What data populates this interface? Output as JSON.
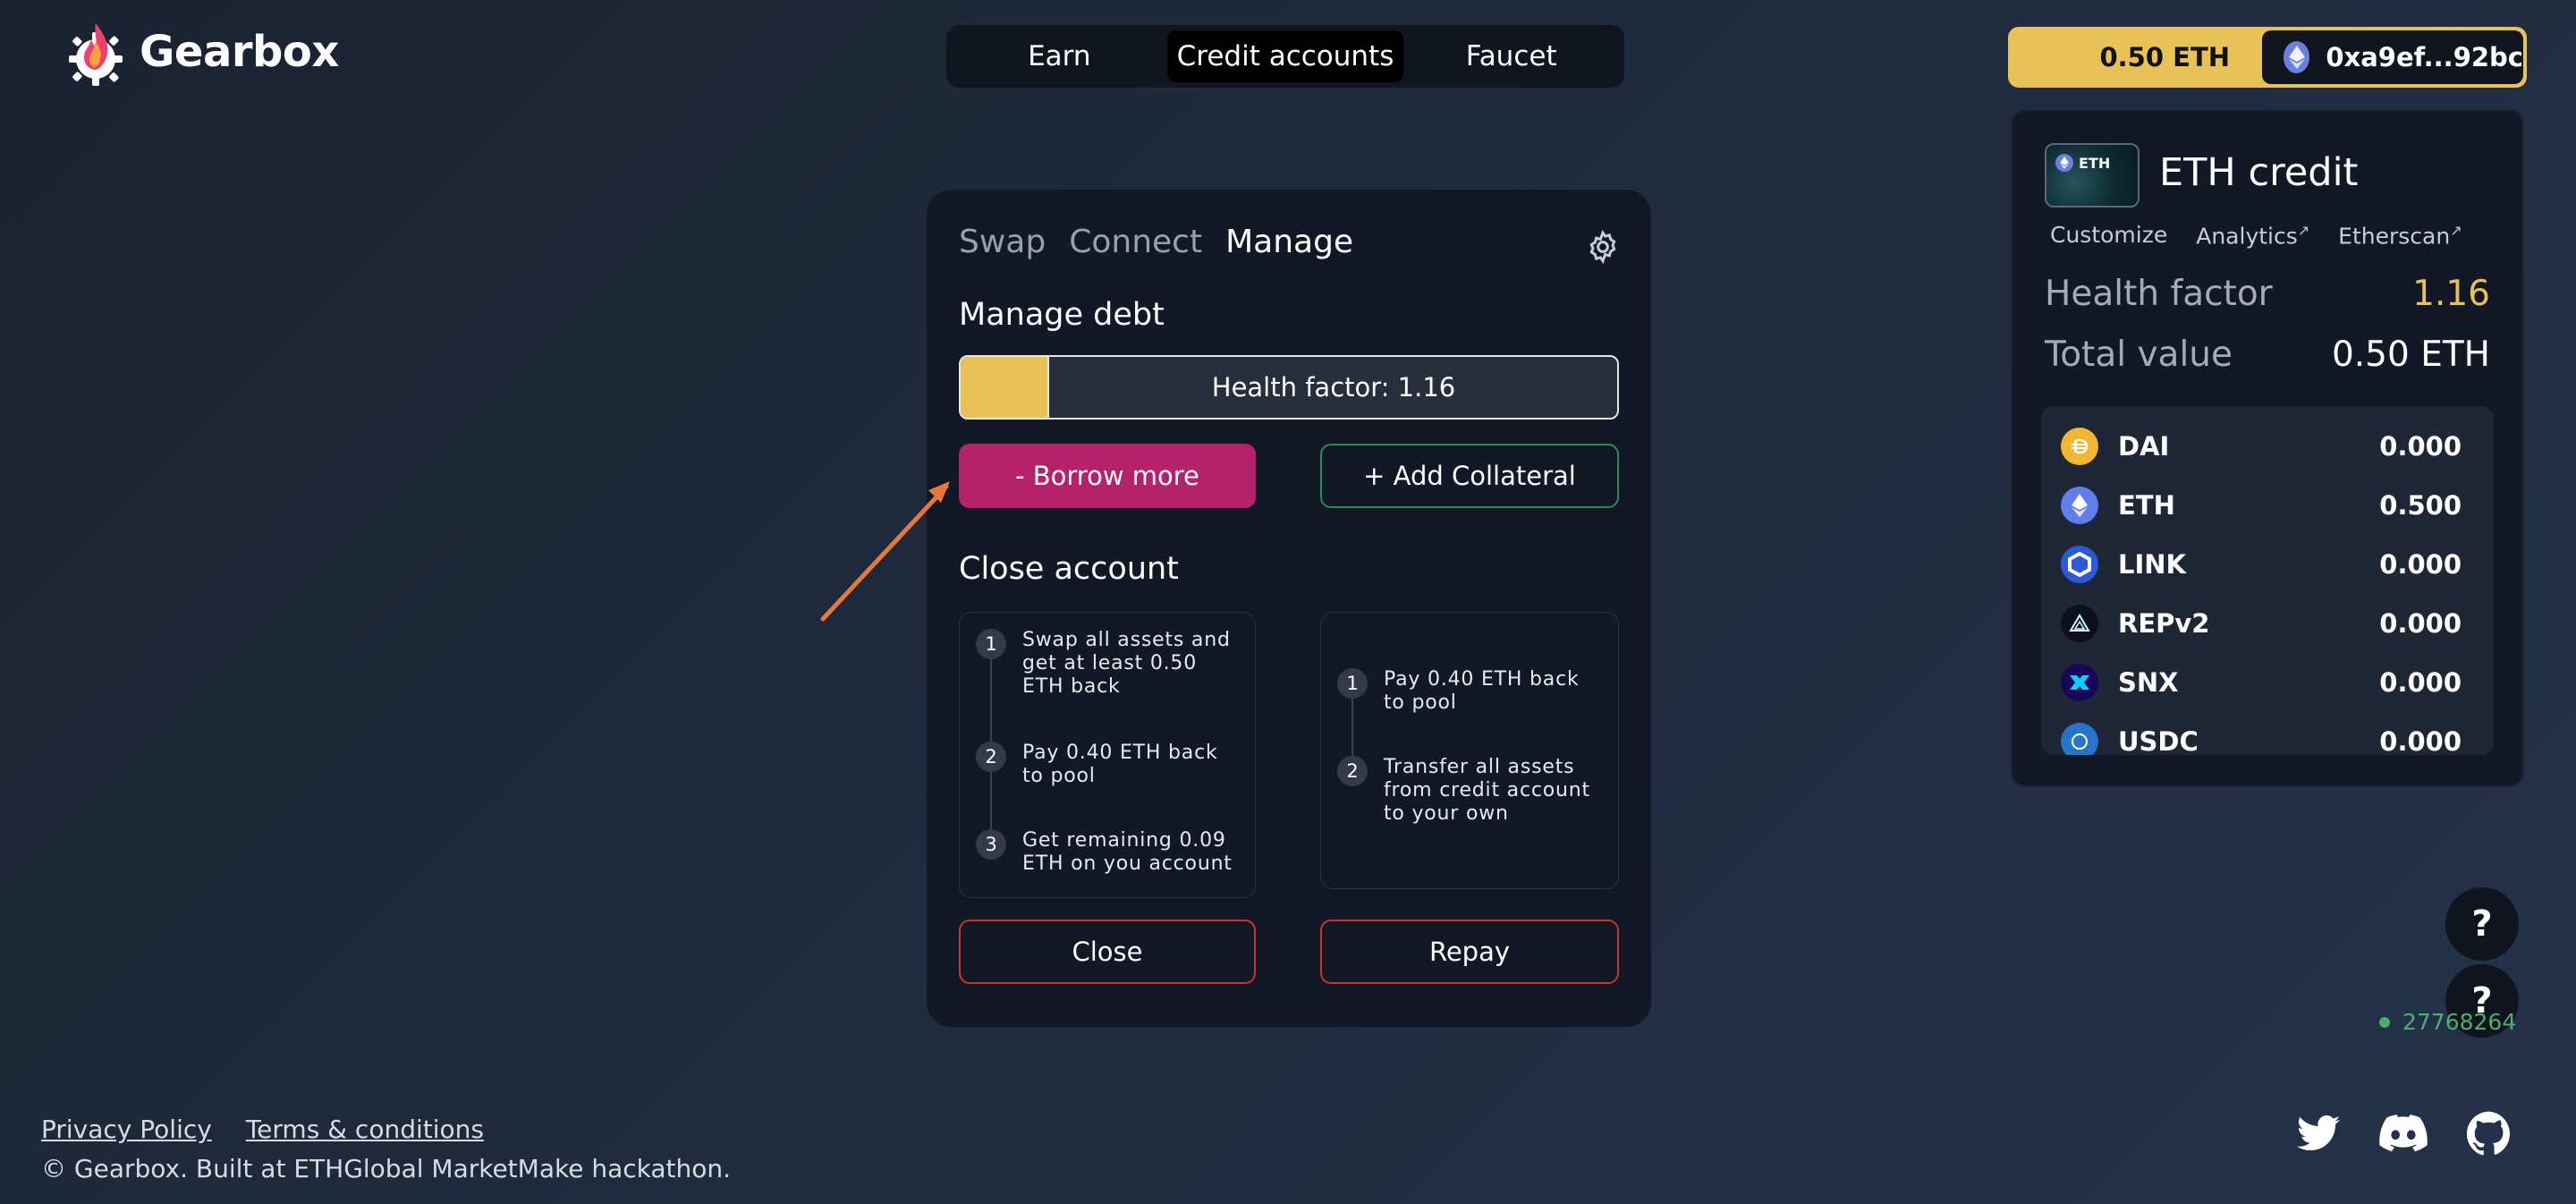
{
  "brand": {
    "name": "Gearbox"
  },
  "nav": {
    "tabs": [
      "Earn",
      "Credit accounts",
      "Faucet"
    ],
    "active": "Credit accounts"
  },
  "wallet": {
    "balance": "0.50 ETH",
    "address": "0xa9ef...92bc"
  },
  "panel": {
    "tabs": [
      "Swap",
      "Connect",
      "Manage"
    ],
    "active_tab": "Manage",
    "manage_debt_title": "Manage debt",
    "health_factor_label": "Health factor: 1.16",
    "health_fill_fraction": 0.135,
    "borrow_more_label": "- Borrow more",
    "add_collateral_label": "+ Add Collateral",
    "close_account_title": "Close account",
    "close_steps": [
      {
        "n": "1",
        "text": "Swap all assets and get at least 0.50 ETH back"
      },
      {
        "n": "2",
        "text": "Pay 0.40 ETH back to pool"
      },
      {
        "n": "3",
        "text": "Get remaining 0.09 ETH on you account"
      }
    ],
    "repay_steps": [
      {
        "n": "1",
        "text": "Pay 0.40 ETH back to pool"
      },
      {
        "n": "2",
        "text": "Transfer all assets from credit account to your own"
      }
    ],
    "close_label": "Close",
    "repay_label": "Repay"
  },
  "account": {
    "thumb_label": "ETH",
    "title": "ETH credit",
    "links": {
      "customize": "Customize",
      "analytics": "Analytics",
      "etherscan": "Etherscan",
      "external_mark": "↗"
    },
    "health_factor_label": "Health factor",
    "health_factor_value": "1.16",
    "total_value_label": "Total value",
    "total_value_value": "0.50 ETH",
    "tokens": [
      {
        "symbol": "DAI",
        "amount": "0.000",
        "color": "#f4b731"
      },
      {
        "symbol": "ETH",
        "amount": "0.500",
        "color": "#627eea"
      },
      {
        "symbol": "LINK",
        "amount": "0.000",
        "color": "#2a5ada"
      },
      {
        "symbol": "REPv2",
        "amount": "0.000",
        "color": "#0e0e21"
      },
      {
        "symbol": "SNX",
        "amount": "0.000",
        "color": "#170659"
      },
      {
        "symbol": "USDC",
        "amount": "0.000",
        "color": "#2775ca"
      }
    ]
  },
  "help": {
    "glyph": "?"
  },
  "block_number": "27768264",
  "footer": {
    "privacy": "Privacy Policy",
    "terms": "Terms & conditions",
    "copyright": "© Gearbox. Built at ETHGlobal MarketMake hackathon."
  },
  "colors": {
    "accent_yellow": "#e8c257",
    "borrow_pink": "#b3226b",
    "collateral_green": "#2f8a5e",
    "danger_red": "#c8342a",
    "health_value": "#e8c257"
  }
}
